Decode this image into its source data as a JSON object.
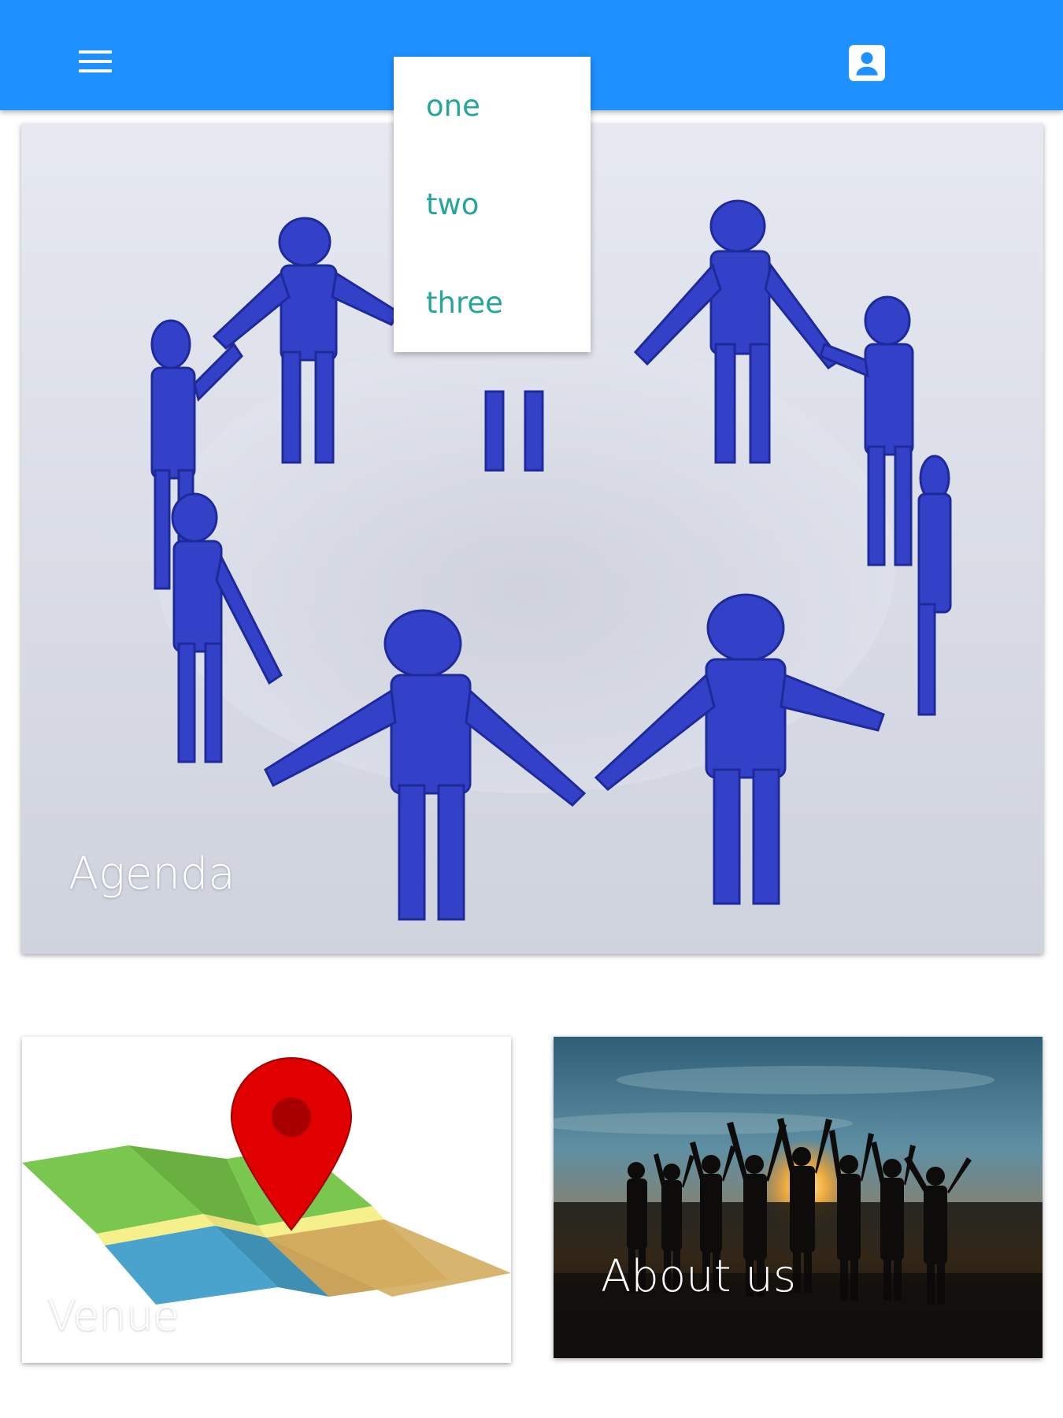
{
  "appbar": {
    "menu_icon": "hamburger-menu-icon",
    "account_icon": "account-box-icon",
    "color": "#1e90ff"
  },
  "dropdown": {
    "items": [
      "one",
      "two",
      "three"
    ],
    "text_color": "#26a69a"
  },
  "cards": {
    "agenda": {
      "label": "Agenda"
    },
    "venue": {
      "label": "Venue"
    },
    "about": {
      "label": "About us"
    }
  }
}
